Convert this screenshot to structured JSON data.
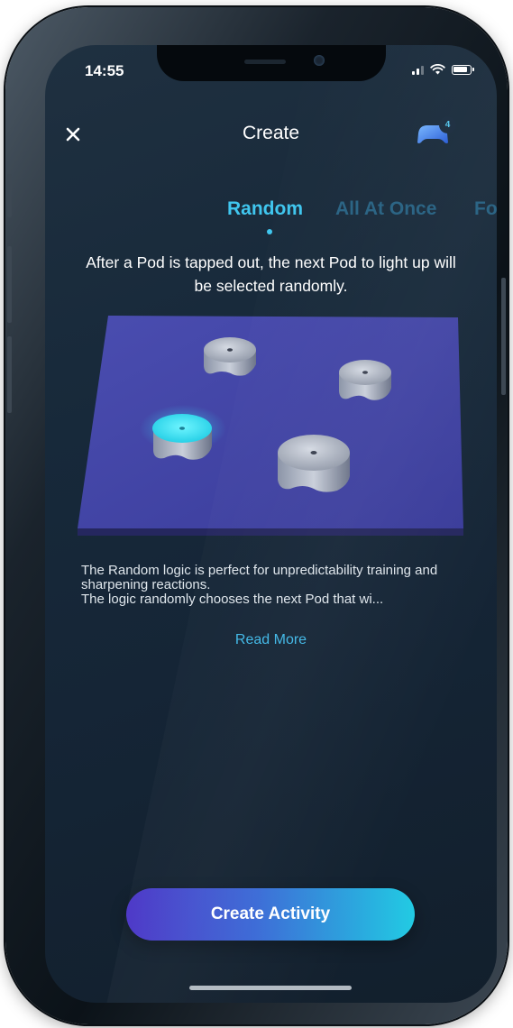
{
  "status_bar": {
    "time": "14:55"
  },
  "header": {
    "title": "Create",
    "close_icon": "close-icon",
    "pod_icon": "pod-controller-icon",
    "pod_count": "4"
  },
  "tabs": [
    {
      "label": "Random",
      "active": true
    },
    {
      "label": "All At Once",
      "active": false
    },
    {
      "label": "Fo",
      "active": false
    }
  ],
  "mode": {
    "subtitle": "After a Pod is tapped out, the next Pod to light up will be selected randomly.",
    "description_line1": "The Random logic is perfect for unpredictability training and sharpening reactions.",
    "description_line2": "The logic randomly chooses the next Pod that wi...",
    "read_more": "Read More"
  },
  "illustration": {
    "pods_total": 4,
    "pods_lit": 1,
    "lit_color": "#2fe0ef",
    "floor_color": "#3a3c9a"
  },
  "primary_action": {
    "label": "Create Activity"
  },
  "colors": {
    "accent": "#40c6ee",
    "button_start": "#4a34c6",
    "button_end": "#22cbe3",
    "background": "#17293a"
  }
}
